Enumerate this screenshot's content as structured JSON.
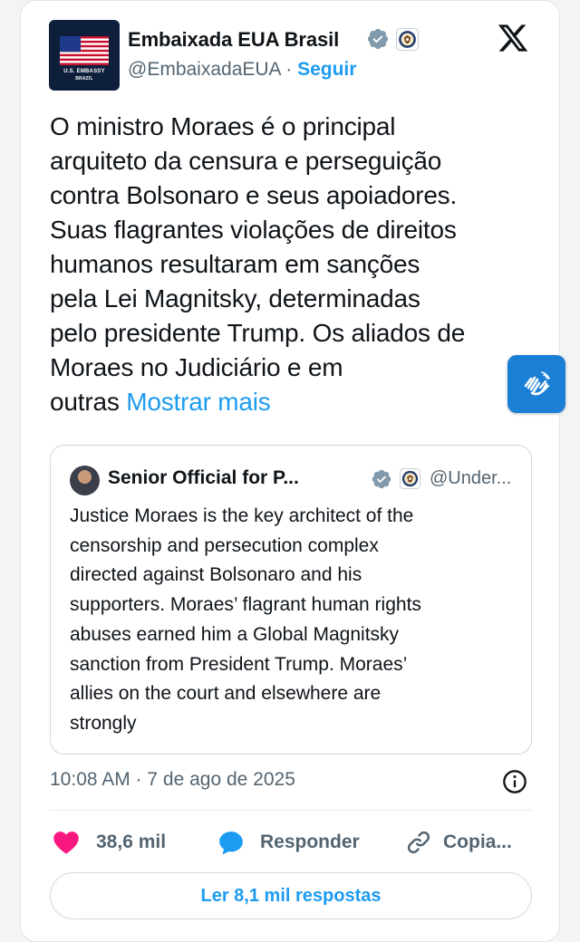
{
  "post": {
    "author": {
      "display_name": "Embaixada EUA Brasil",
      "handle": "@EmbaixadaEUA",
      "separator": " · ",
      "follow_label": "Seguir",
      "avatar_caption_line1": "U.S. EMBASSY",
      "avatar_caption_line2": "BRAZIL",
      "verified_icon": "verified-badge-icon",
      "affiliation_icon": "us-state-department-seal-icon"
    },
    "platform_icon": "x-logo-icon",
    "text_lines": [
      "O ministro Moraes é o principal",
      "arquiteto da censura e perseguição",
      "contra Bolsonaro e seus apoiadores.",
      "Suas flagrantes violações de direitos",
      "humanos resultaram em sanções",
      "pela Lei Magnitsky, determinadas",
      "pelo presidente Trump. Os aliados de",
      "Moraes no Judiciário e em"
    ],
    "text_last_line": "outras ",
    "show_more_label": "Mostrar mais",
    "timestamp": "10:08 AM · 7 de ago de 2025",
    "likes": "38,6 mil",
    "reply_label": "Responder",
    "copy_label": "Copia...",
    "read_replies_label": "Ler 8,1 mil respostas"
  },
  "quote": {
    "display_name": "Senior Official for P...",
    "handle": "@Under...",
    "text_lines": [
      "Justice Moraes is the key architect of the",
      "censorship and persecution complex",
      "directed against Bolsonaro and his",
      "supporters. Moraes’ flagrant human rights",
      "abuses earned him a Global Magnitsky",
      "sanction from President Trump. Moraes’",
      "allies on the court and elsewhere are",
      "strongly"
    ]
  },
  "colors": {
    "accent": "#1d9bf0",
    "secondary_text": "#536471",
    "like_heart": "#f91880",
    "accessibility_button": "#1b7fd6"
  }
}
